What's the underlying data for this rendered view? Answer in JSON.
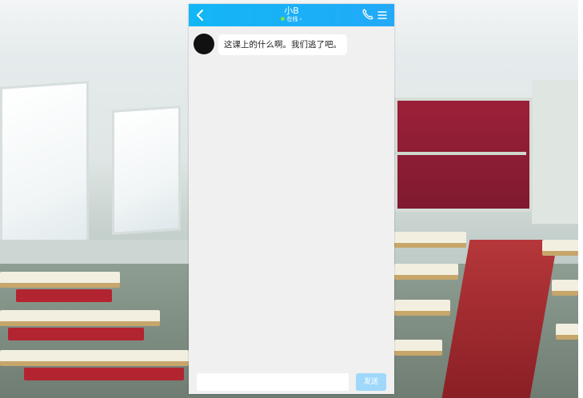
{
  "chat": {
    "contact_name": "小B",
    "status_text": "在线 ›",
    "back_icon": "chevron-left-icon",
    "call_icon": "phone-icon",
    "menu_icon": "menu-icon"
  },
  "messages": [
    {
      "sender": "contact",
      "text": "这课上的什么啊。我们逃了吧。"
    }
  ],
  "composer": {
    "input_value": "",
    "placeholder": "",
    "send_label": "发送"
  },
  "colors": {
    "titlebar": "#12b7f5",
    "send_disabled": "#9fd8fb",
    "online_dot": "#7de23c",
    "chat_bg": "#f0f0f0"
  }
}
